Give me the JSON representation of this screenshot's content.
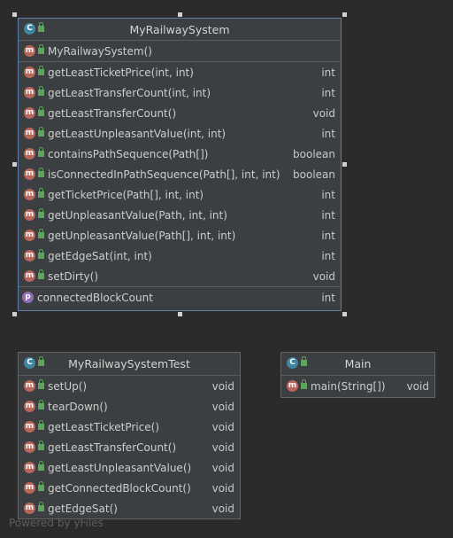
{
  "classes": {
    "railway": {
      "title": "MyRailwaySystem",
      "constructor": "MyRailwaySystem()",
      "methods": [
        {
          "name": "getLeastTicketPrice(int, int)",
          "type": "int"
        },
        {
          "name": "getLeastTransferCount(int, int)",
          "type": "int"
        },
        {
          "name": "getLeastTransferCount()",
          "type": "void"
        },
        {
          "name": "getLeastUnpleasantValue(int, int)",
          "type": "int"
        },
        {
          "name": "containsPathSequence(Path[])",
          "type": "boolean"
        },
        {
          "name": "isConnectedInPathSequence(Path[], int, int)",
          "type": "boolean"
        },
        {
          "name": "getTicketPrice(Path[], int, int)",
          "type": "int"
        },
        {
          "name": "getUnpleasantValue(Path, int, int)",
          "type": "int"
        },
        {
          "name": "getUnpleasantValue(Path[], int, int)",
          "type": "int"
        },
        {
          "name": "getEdgeSat(int, int)",
          "type": "int"
        },
        {
          "name": "setDirty()",
          "type": "void"
        }
      ],
      "fields": [
        {
          "name": "connectedBlockCount",
          "type": "int"
        }
      ]
    },
    "test": {
      "title": "MyRailwaySystemTest",
      "methods": [
        {
          "name": "setUp()",
          "type": "void"
        },
        {
          "name": "tearDown()",
          "type": "void"
        },
        {
          "name": "getLeastTicketPrice()",
          "type": "void"
        },
        {
          "name": "getLeastTransferCount()",
          "type": "void"
        },
        {
          "name": "getLeastUnpleasantValue()",
          "type": "void"
        },
        {
          "name": "getConnectedBlockCount()",
          "type": "void"
        },
        {
          "name": "getEdgeSat()",
          "type": "void"
        }
      ]
    },
    "main": {
      "title": "Main",
      "methods": [
        {
          "name": "main(String[])",
          "type": "void"
        }
      ]
    }
  },
  "badges": {
    "class": "C",
    "method": "m",
    "field": "p"
  },
  "footer": "Powered by yFiles"
}
